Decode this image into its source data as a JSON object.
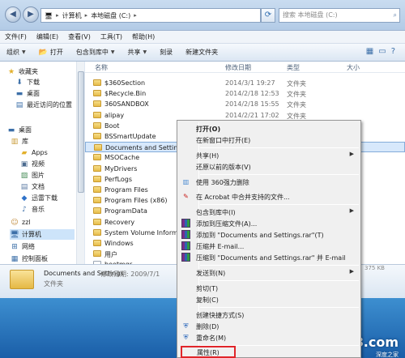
{
  "address": {
    "segments": [
      "计算机",
      "本地磁盘 (C:)"
    ],
    "search_placeholder": "搜索 本地磁盘 (C:)"
  },
  "menubar": [
    "文件(F)",
    "编辑(E)",
    "查看(V)",
    "工具(T)",
    "帮助(H)"
  ],
  "toolbar": {
    "organize": "组织",
    "open": "打开",
    "include_library": "包含到库中",
    "share": "共享",
    "burn": "刻录",
    "new_folder": "新建文件夹"
  },
  "nav": {
    "favorites": "收藏夹",
    "downloads": "下载",
    "desktop": "桌面",
    "recent": "最近访问的位置",
    "desktop2": "桌面",
    "libraries": "库",
    "apps": "Apps",
    "videos": "视频",
    "pictures": "图片",
    "documents": "文档",
    "thunder": "迅雷下载",
    "music": "音乐",
    "user": "zzl",
    "computer": "计算机",
    "network": "网络",
    "control_panel": "控制面板"
  },
  "columns": {
    "name": "名称",
    "date": "修改日期",
    "type": "类型",
    "size": "大小"
  },
  "files": [
    {
      "name": "$360Section",
      "date": "2014/3/1 19:27",
      "type": "文件夹"
    },
    {
      "name": "$Recycle.Bin",
      "date": "2014/2/18 12:53",
      "type": "文件夹"
    },
    {
      "name": "360SANDBOX",
      "date": "2014/2/18 15:55",
      "type": "文件夹"
    },
    {
      "name": "alipay",
      "date": "2014/2/21 17:02",
      "type": "文件夹"
    },
    {
      "name": "Boot",
      "date": "2014/2/18 13:09",
      "type": "文件夹"
    },
    {
      "name": "BSSmartUpdate",
      "date": "",
      "type": ""
    },
    {
      "name": "Documents and Settings",
      "date": "",
      "type": ""
    },
    {
      "name": "MSOCache",
      "date": "",
      "type": ""
    },
    {
      "name": "MyDrivers",
      "date": "",
      "type": ""
    },
    {
      "name": "PerfLogs",
      "date": "",
      "type": ""
    },
    {
      "name": "Program Files",
      "date": "",
      "type": ""
    },
    {
      "name": "Program Files (x86)",
      "date": "",
      "type": ""
    },
    {
      "name": "ProgramData",
      "date": "",
      "type": ""
    },
    {
      "name": "Recovery",
      "date": "",
      "type": ""
    },
    {
      "name": "System Volume Informat",
      "date": "",
      "type": ""
    },
    {
      "name": "Windows",
      "date": "",
      "type": ""
    },
    {
      "name": "用户",
      "date": "",
      "type": ""
    },
    {
      "name": "bootmgr",
      "date": "",
      "type": ""
    }
  ],
  "details": {
    "name": "Documents and Settings",
    "modified_label": "修改日期: 2009/7/1",
    "kind": "文件夹",
    "size_tail": "375 KB"
  },
  "context_menu": {
    "open": "打开(O)",
    "open_new_window": "在新窗口中打开(E)",
    "share": "共享(H)",
    "restore_versions": "还原以前的版本(V)",
    "force_delete_360": "使用 360强力删除",
    "acrobat_merge": "在 Acrobat 中合并支持的文件...",
    "include_library": "包含到库中(I)",
    "add_archive": "添加到压缩文件(A)...",
    "add_to_rar": "添加到 \"Documents and Settings.rar\"(T)",
    "compress_email": "压缩并 E-mail...",
    "compress_rar_email": "压缩到 \"Documents and Settings.rar\" 并 E-mail",
    "send_to": "发送到(N)",
    "cut": "剪切(T)",
    "copy": "复制(C)",
    "create_shortcut": "创建快捷方式(S)",
    "delete": "删除(D)",
    "rename": "重命名(M)",
    "properties": "属性(R)"
  },
  "watermark": {
    "main": "Shenduwin8.com",
    "sub": "深度之家"
  }
}
